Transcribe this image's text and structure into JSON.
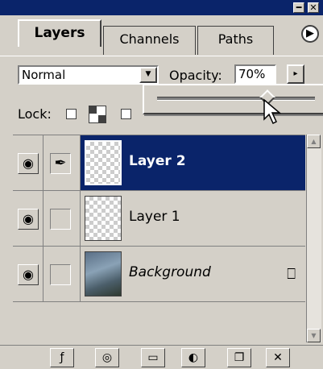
{
  "window": {
    "minimize_glyph": "━",
    "close_glyph": "✕"
  },
  "tabs": [
    {
      "label": "Layers",
      "active": true
    },
    {
      "label": "Channels",
      "active": false
    },
    {
      "label": "Paths",
      "active": false
    }
  ],
  "palette_menu_glyph": "▶",
  "blend": {
    "mode": "Normal",
    "arrow_glyph": "▼"
  },
  "opacity": {
    "label": "Opacity:",
    "value": "70%",
    "arrow_glyph": "▸",
    "slider_fraction": 0.7
  },
  "lock": {
    "label": "Lock:"
  },
  "layers": [
    {
      "name": "Layer 2",
      "selected": true,
      "visible": true,
      "brush": true
    },
    {
      "name": "Layer 1",
      "selected": false,
      "visible": true,
      "brush": false
    },
    {
      "name": "Background",
      "selected": false,
      "visible": true,
      "brush": false,
      "locked": true
    }
  ],
  "icons": {
    "eye": "◉",
    "brush": "✒",
    "lock": "⎕"
  },
  "bottom_buttons": [
    {
      "name": "layer-style-button",
      "glyph": "ƒ"
    },
    {
      "name": "add-mask-button",
      "glyph": "◎"
    },
    {
      "name": "new-set-button",
      "glyph": "▭"
    },
    {
      "name": "adjustment-layer-button",
      "glyph": "◐"
    },
    {
      "name": "new-layer-button",
      "glyph": "❐"
    },
    {
      "name": "delete-layer-button",
      "glyph": "✕"
    }
  ],
  "colors": {
    "titlebar": "#0a246a",
    "selection": "#0a246a",
    "panel": "#d4d0c8"
  }
}
